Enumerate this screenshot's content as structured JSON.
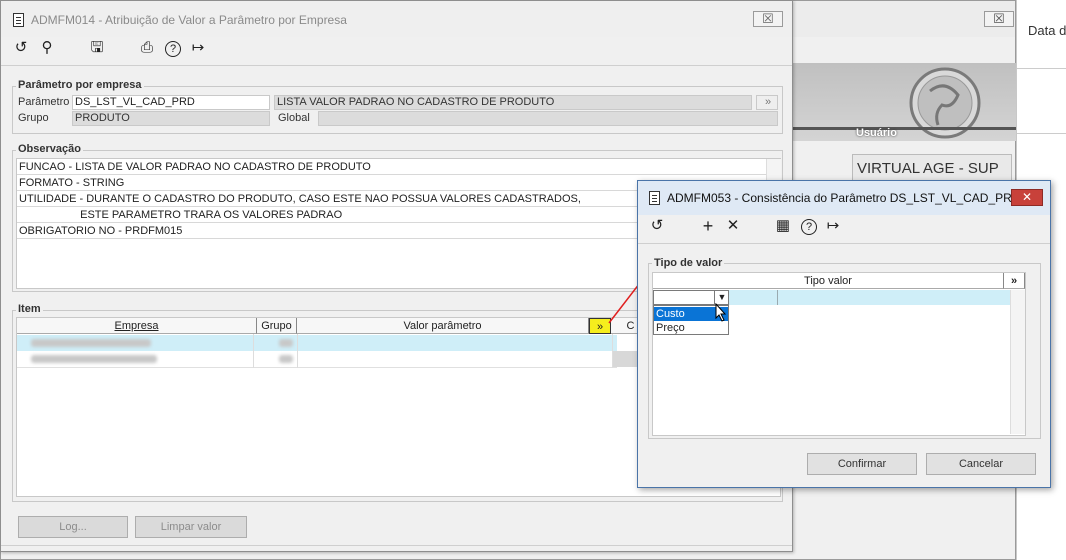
{
  "background": {
    "right_panel_text": "Data d",
    "banner_label": "Usuário",
    "virtual_age_label": "VIRTUAL AGE - SUP",
    "close_glyph": "☒"
  },
  "main_window": {
    "title": "ADMFM014 - Atribuição de Valor a Parâmetro por Empresa",
    "close_glyph": "☒",
    "toolbar": {
      "undo": "↺",
      "search": "⚲",
      "save": "🖫",
      "print": "⎙",
      "help": "?",
      "exit": "↦"
    },
    "parametro_group": {
      "title": "Parâmetro por empresa",
      "parametro_label": "Parâmetro",
      "parametro_value": "DS_LST_VL_CAD_PRD",
      "descricao_value": "LISTA VALOR PADRAO NO CADASTRO DE PRODUTO",
      "lookup_glyph": "»",
      "grupo_label": "Grupo",
      "grupo_value": "PRODUTO",
      "global_label": "Global",
      "global_value": ""
    },
    "observacao": {
      "title": "Observação",
      "lines": [
        "FUNCAO - LISTA DE VALOR PADRAO NO CADASTRO DE PRODUTO",
        "FORMATO - STRING",
        "UTILIDADE - DURANTE O CADASTRO DO PRODUTO, CASO ESTE NAO POSSUA VALORES CADASTRADOS,",
        "                    ESTE PARAMETRO TRARA OS VALORES PADRAO",
        "OBRIGATORIO NO - PRDFM015"
      ]
    },
    "item": {
      "title": "Item",
      "columns": [
        "Empresa",
        "Grupo",
        "Valor parâmetro",
        "»",
        "C"
      ]
    },
    "buttons": {
      "log": "Log...",
      "limpar": "Limpar valor"
    }
  },
  "dialog": {
    "title": "ADMFM053 - Consistência do Parâmetro DS_LST_VL_CAD_PRD",
    "close_glyph": "✕",
    "toolbar": {
      "undo": "↺",
      "add": "+",
      "delete": "✕",
      "calendar": "▦",
      "help": "?",
      "exit": "↦"
    },
    "group_title": "Tipo de valor",
    "column_header": "Tipo valor",
    "more_glyph": "»",
    "dropdown_options": [
      "Custo",
      "Preço"
    ],
    "selected_option": "Custo",
    "confirm_label": "Confirmar",
    "cancel_label": "Cancelar"
  }
}
